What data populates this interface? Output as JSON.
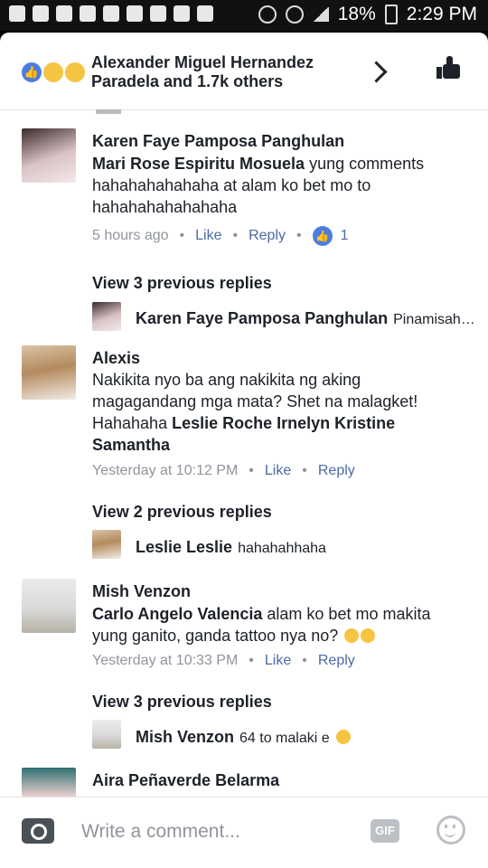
{
  "status": {
    "battery": "18%",
    "time": "2:29 PM"
  },
  "header": {
    "reactors": "Alexander Miguel Hernandez Paradela and 1.7k others"
  },
  "comments": [
    {
      "name": "Karen Faye Pamposa Panghulan",
      "mention": "Mari Rose Espiritu Mosuela",
      "text": " yung comments hahahahahahaha at alam ko bet mo to hahahahahahahaha",
      "time": "5 hours ago",
      "like": "Like",
      "reply": "Reply",
      "like_count": "1",
      "view_prev": "View 3 previous replies",
      "reply_name": "Karen Faye Pamposa Panghulan",
      "reply_text": "Pinamisah…"
    },
    {
      "name": "Alexis",
      "text": "Nakikita nyo ba ang nakikita ng aking magagandang mga mata? Shet na malagket! Hahahaha ",
      "mention": "Leslie Roche Irnelyn Kristine Samantha",
      "time": "Yesterday at 10:12 PM",
      "like": "Like",
      "reply": "Reply",
      "view_prev": "View 2 previous replies",
      "reply_name": "Leslie Leslie",
      "reply_text": "hahahahhaha"
    },
    {
      "name": "Mish Venzon",
      "mention": "Carlo Angelo Valencia",
      "text": " alam ko bet mo makita yung ganito, ganda tattoo nya no?",
      "time": "Yesterday at 10:33 PM",
      "like": "Like",
      "reply": "Reply",
      "view_prev": "View 3 previous replies",
      "reply_name": "Mish Venzon",
      "reply_text": "64 to malaki e"
    },
    {
      "name": "Aira Peñaverde Belarma"
    }
  ],
  "composer": {
    "placeholder": "Write a comment...",
    "gif": "GIF"
  }
}
